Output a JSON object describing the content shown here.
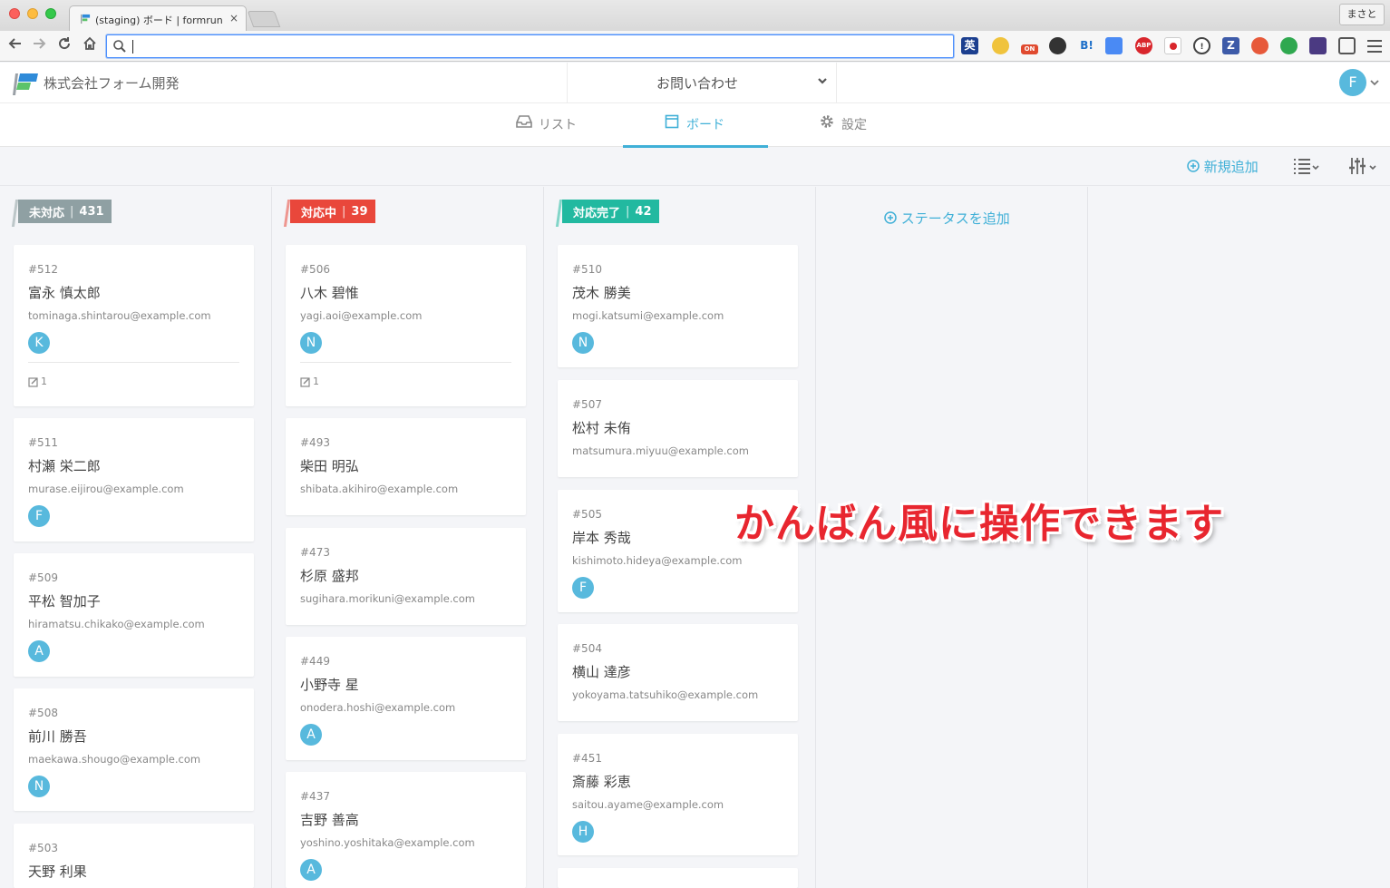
{
  "browser": {
    "tab_title": "(staging) ボード | formrun",
    "tab_close": "×",
    "profile": "まさと",
    "url": ""
  },
  "app": {
    "company": "株式会社フォーム開発",
    "form_name": "お問い合わせ",
    "user_initial": "F",
    "accent": "#40b0d7"
  },
  "tabs": [
    {
      "label": "リスト",
      "icon": "inbox-icon"
    },
    {
      "label": "ボード",
      "icon": "board-icon",
      "active": true
    },
    {
      "label": "設定",
      "icon": "gear-icon"
    }
  ],
  "board_toolbar": {
    "add_new": "新規追加"
  },
  "columns": [
    {
      "label": "未対応",
      "count": "431",
      "color": "#8fa0a3",
      "cards": [
        {
          "id": "#512",
          "name": "富永 慎太郎",
          "email": "tominaga.shintarou@example.com",
          "assignee": "K",
          "comments": "1"
        },
        {
          "id": "#511",
          "name": "村瀬 栄二郎",
          "email": "murase.eijirou@example.com",
          "assignee": "F"
        },
        {
          "id": "#509",
          "name": "平松 智加子",
          "email": "hiramatsu.chikako@example.com",
          "assignee": "A"
        },
        {
          "id": "#508",
          "name": "前川 勝吾",
          "email": "maekawa.shougo@example.com",
          "assignee": "N"
        },
        {
          "id": "#503",
          "name": "天野 利果"
        }
      ]
    },
    {
      "label": "対応中",
      "count": "39",
      "color": "#e9473b",
      "cards": [
        {
          "id": "#506",
          "name": "八木 碧惟",
          "email": "yagi.aoi@example.com",
          "assignee": "N",
          "comments": "1"
        },
        {
          "id": "#493",
          "name": "柴田 明弘",
          "email": "shibata.akihiro@example.com"
        },
        {
          "id": "#473",
          "name": "杉原 盛邦",
          "email": "sugihara.morikuni@example.com"
        },
        {
          "id": "#449",
          "name": "小野寺 星",
          "email": "onodera.hoshi@example.com",
          "assignee": "A"
        },
        {
          "id": "#437",
          "name": "吉野 善高",
          "email": "yoshino.yoshitaka@example.com",
          "assignee": "A"
        }
      ]
    },
    {
      "label": "対応完了",
      "count": "42",
      "color": "#22b9a0",
      "cards": [
        {
          "id": "#510",
          "name": "茂木 勝美",
          "email": "mogi.katsumi@example.com",
          "assignee": "N"
        },
        {
          "id": "#507",
          "name": "松村 未侑",
          "email": "matsumura.miyuu@example.com"
        },
        {
          "id": "#505",
          "name": "岸本 秀哉",
          "email": "kishimoto.hideya@example.com",
          "assignee": "F"
        },
        {
          "id": "#504",
          "name": "横山 達彦",
          "email": "yokoyama.tatsuhiko@example.com"
        },
        {
          "id": "#451",
          "name": "斎藤 彩恵",
          "email": "saitou.ayame@example.com",
          "assignee": "H"
        }
      ]
    }
  ],
  "add_status": "ステータスを追加",
  "overlay_caption": "かんばん風に操作できます"
}
